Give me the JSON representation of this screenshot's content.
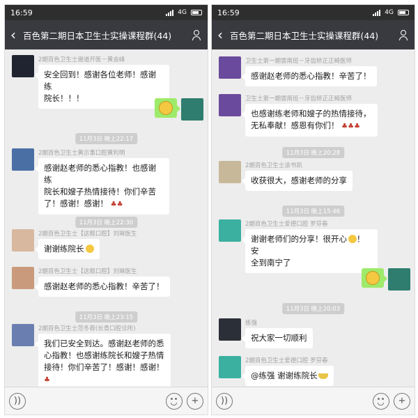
{
  "left": {
    "status_time": "16:59",
    "network": "4G",
    "title": "百色第二期日本卫生士实操课程群(44)",
    "messages": [
      {
        "sender": "2期百色卫生士谢道开医－黄会峰",
        "text": [
          "安全回到！感谢各位老师！感谢练",
          "院长！！！"
        ]
      },
      {
        "timestamp": "11月3日 晚上22:17"
      },
      {
        "sender": "2期百色卫生士黄示事口腔黄利明",
        "text": [
          "感谢赵老师的悉心指教！也感谢练",
          "院长和嫂子热情接待！你们辛苦",
          "了！感谢！感谢！"
        ]
      },
      {
        "timestamp": "11月3日 晚上22:30"
      },
      {
        "sender": "2期百色卫生士【这舰口腔】刘琳医生",
        "text": [
          "谢谢练院长"
        ]
      },
      {
        "sender": "2期百色卫生士【这舰口腔】刘琳医生",
        "text": [
          "感谢赵老师的悉心指教！辛苦了！"
        ]
      },
      {
        "timestamp": "11月3日 晚上23:15"
      },
      {
        "sender": "2期百色卫生士范冬蓉(长青口腔诊所)",
        "text": [
          "我们已安全到达。感谢赵老师的悉",
          "心指教！也感谢练院长和嫂子热情",
          "接待！你们辛苦了！感谢！感谢！"
        ]
      }
    ]
  },
  "right": {
    "status_time": "16:59",
    "network": "4G",
    "title": "百色第二期日本卫生士实操课程群(44)",
    "messages": [
      {
        "sender": "卫生士第一期雲南班－牙齿矫正正畸医师",
        "text": [
          "感谢赵老师的悉心指教！辛苦了！"
        ]
      },
      {
        "sender": "卫生士第一期雲南班－牙齿矫正正畸医师",
        "text": [
          "也感谢练老师和嫂子的热情接待，",
          "无私奉献！感恩有你们！"
        ]
      },
      {
        "timestamp": "11月3日 晚上20:28"
      },
      {
        "sender": "2期百色卫生士涂书凯",
        "text": [
          "收获很大，感谢老师的分享"
        ]
      },
      {
        "timestamp": "11月3日 晚上15:46"
      },
      {
        "sender": "2期百色卫生士爱德口腔 罗芬春",
        "text": [
          "谢谢老师们的分享！很开心",
          "全到南宁了"
        ],
        "text_tail": "！安"
      },
      {
        "timestamp": "11月3日 晚上20:03"
      },
      {
        "sender": "练强",
        "text": [
          "祝大家一切顺利"
        ]
      },
      {
        "sender": "2期百色卫生士爱德口腔 罗芬春",
        "text": [
          "@练强  谢谢练院长"
        ]
      }
    ]
  },
  "colors": {
    "titlebar": "#393a3f",
    "chat_bg": "#ededed",
    "self_bubble": "#9eea6a"
  },
  "icons": {
    "back": "‹",
    "plus": "+"
  }
}
